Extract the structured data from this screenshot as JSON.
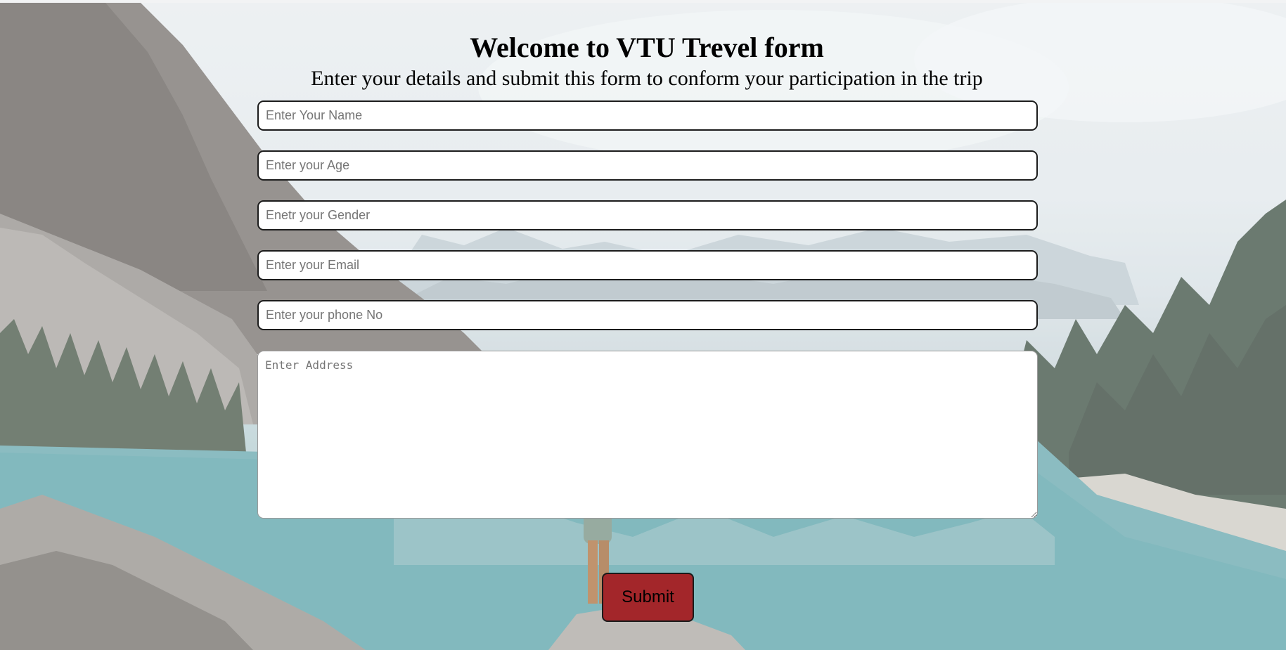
{
  "page": {
    "title": "Welcome to VTU Trevel form",
    "subtitle": "Enter your details and submit this form to conform your participation in the trip"
  },
  "form": {
    "name_placeholder": "Enter Your Name",
    "age_placeholder": "Enter your Age",
    "gender_placeholder": "Enetr your Gender",
    "email_placeholder": "Enter your Email",
    "phone_placeholder": "Enter your phone No",
    "address_placeholder": "Enter Address",
    "submit_label": "Submit"
  },
  "colors": {
    "submit_button": "#a3262a",
    "field_background": "#ffffff",
    "field_border": "#1c1c1c"
  }
}
